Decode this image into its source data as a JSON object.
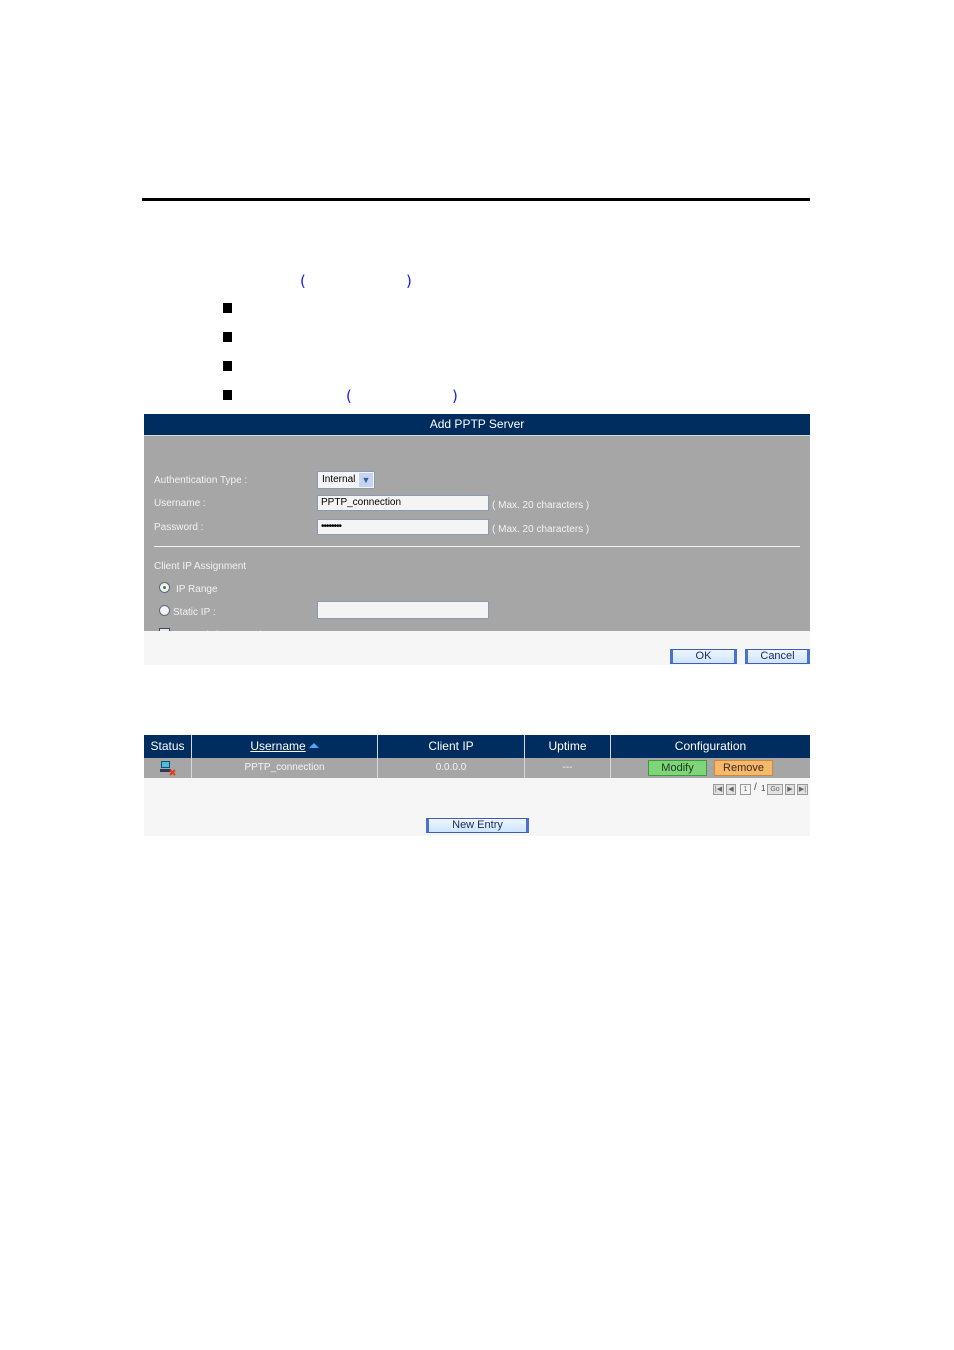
{
  "document": {
    "bullet_count": 4,
    "paren_open": "(",
    "paren_close": ")"
  },
  "form": {
    "title": "Add PPTP Server",
    "auth_type_label": "Authentication Type :",
    "auth_type_value": "Internal",
    "username_label": "Username :",
    "username_value": "PPTP_connection",
    "username_hint": "( Max. 20 characters )",
    "password_label": "Password :",
    "password_value": "••••••••",
    "password_hint": "( Max. 20 characters )",
    "client_ip_label": "Client IP Assignment",
    "ip_range_label": "IP Range",
    "ip_range_selected": true,
    "static_ip_label": "Static IP :",
    "static_ip_value": "",
    "manual_disconnect_label": "Manual disconnection",
    "manual_disconnect_checked": false,
    "ok_label": "OK",
    "cancel_label": "Cancel"
  },
  "table": {
    "headers": [
      "Status",
      "Username",
      "Client IP",
      "Uptime",
      "Configuration"
    ],
    "sorted_column": "Username",
    "sort_direction": "ascending",
    "rows": [
      {
        "status_icon": "disconnected-computer-icon",
        "username": "PPTP_connection",
        "client_ip": "0.0.0.0",
        "uptime": "---",
        "modify_label": "Modify",
        "remove_label": "Remove"
      }
    ],
    "pagination": {
      "current_page": "1",
      "separator": "/",
      "total_pages": "1",
      "go_label": "Go"
    },
    "new_entry_label": "New Entry"
  },
  "colors": {
    "header_bg": "#002d5f",
    "panel_bg": "#a6a6a6",
    "modify_bg": "#7fd67a",
    "remove_bg": "#f6b86a",
    "paren_color": "#1a1aff"
  }
}
